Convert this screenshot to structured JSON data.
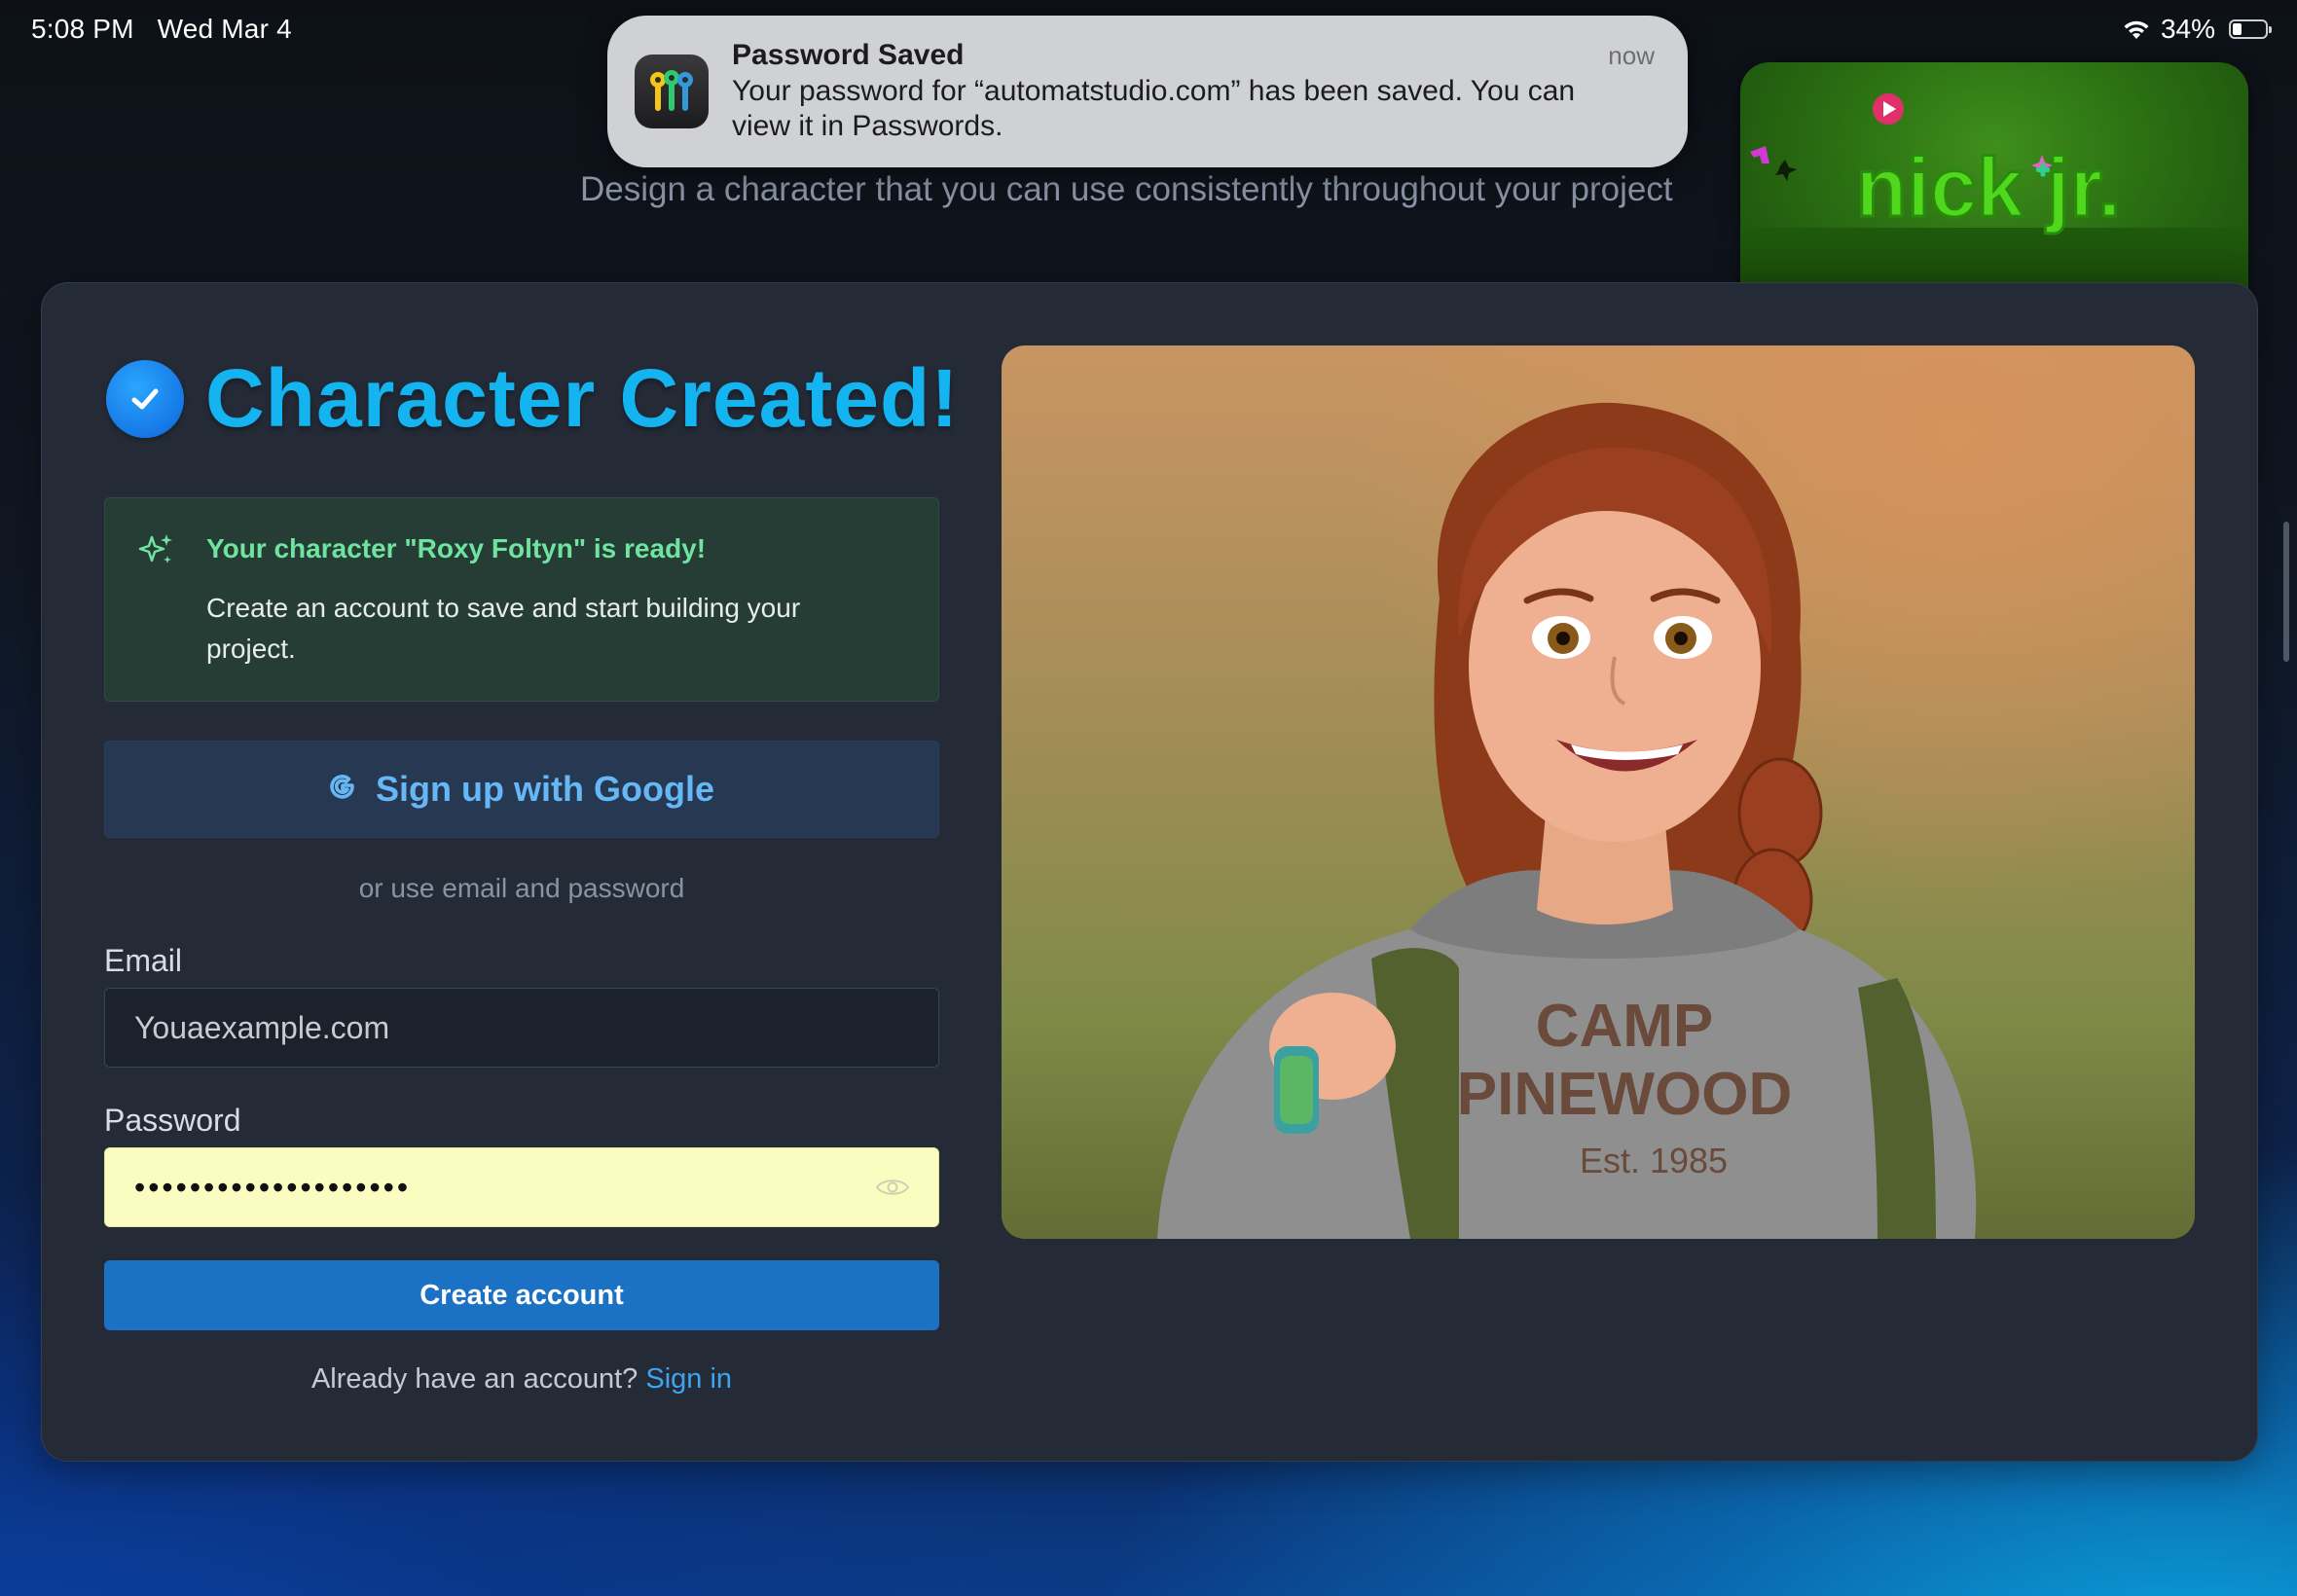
{
  "status_bar": {
    "time": "5:08 PM",
    "date": "Wed Mar 4",
    "battery": "34%",
    "battery_level": 0.34
  },
  "notification": {
    "app_icon": "passwords-keys-icon",
    "title": "Password Saved",
    "time": "now",
    "body": "Your password for “automatstudio.com” has been saved. You can view it in Passwords."
  },
  "pip": {
    "logo": "nick jr."
  },
  "header": {
    "subtitle": "Design a character that you can use consistently throughout your project"
  },
  "card": {
    "title": "Character Created!",
    "success": {
      "title": "Your character \"Roxy Foltyn\" is ready!",
      "text": "Create an account to save and start building your project."
    },
    "google_button": "Sign up with Google",
    "divider": "or use email and password",
    "email": {
      "label": "Email",
      "placeholder": "Youaexample.com"
    },
    "password": {
      "label": "Password",
      "value": "••••••••••••••••••••"
    },
    "create_button": "Create account",
    "signin_prompt": "Already have an account?",
    "signin_link": "Sign in",
    "image": {
      "alt": "Roxy Foltyn",
      "shirt_line1": "CAMP",
      "shirt_line2": "PINEWOOD",
      "shirt_line3": "Est. 1985"
    }
  },
  "colors": {
    "accent": "#13b4f0",
    "primary_button": "#1b71c4",
    "success_text": "#6fe3a0",
    "card_bg": "#242b37",
    "autofill_bg": "#fbfdc0"
  }
}
